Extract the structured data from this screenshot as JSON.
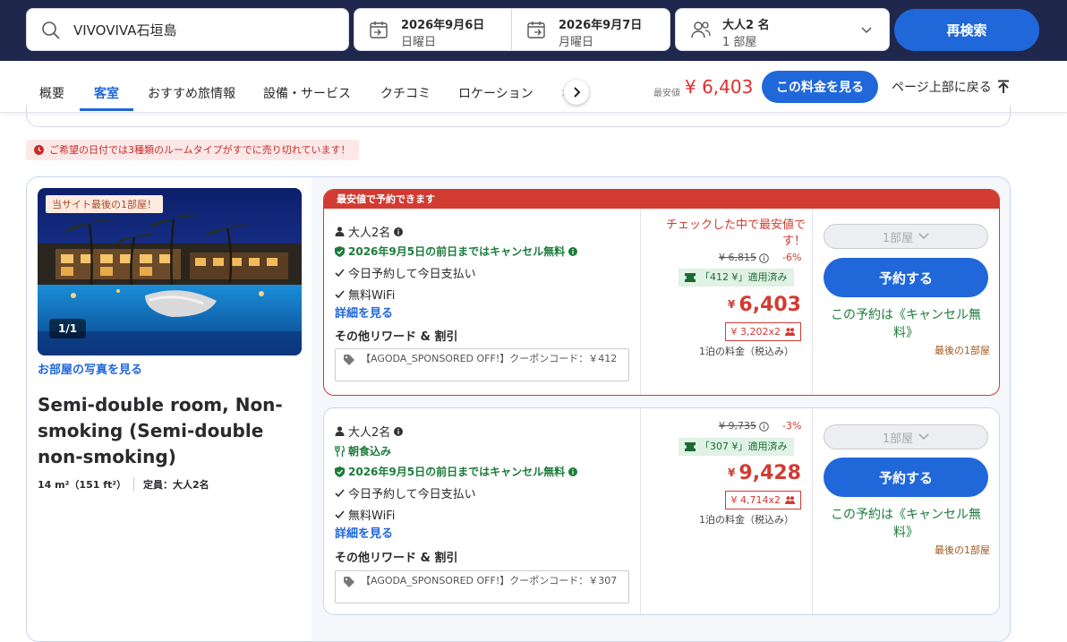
{
  "search": {
    "query": "VIVOVIVA石垣島"
  },
  "checkin": {
    "date": "2026年9月6日",
    "weekday": "日曜日"
  },
  "checkout": {
    "date": "2026年9月7日",
    "weekday": "月曜日"
  },
  "guests": {
    "adults": "大人2 名",
    "rooms": "1 部屋"
  },
  "research_label": "再検索",
  "nav": {
    "tabs": [
      "概要",
      "客室",
      "おすすめ旅情報",
      "設備・サービス",
      "クチコミ",
      "ロケーション"
    ],
    "hidden_tab_fragment": "ポ",
    "min_label": "最安値",
    "min_price": "¥ 6,403",
    "see_price": "この料金を見る",
    "back_top": "ページ上部に戻る"
  },
  "soldout_notice": "ご希望の日付では3種類のルームタイプがすでに売り切れています！",
  "room": {
    "last_room_badge": "当サイト最後の1部屋！",
    "photo_counter": "1/1",
    "photo_link": "お部屋の写真を見る",
    "name": "Semi-double room, Non-smoking (Semi-double non-smoking)",
    "size": "14 m²（151 ft²）",
    "capacity": "定員：大人2名"
  },
  "offers": [
    {
      "best_label": "最安値で予約できます",
      "occupancy": "大人2名",
      "breakfast": "",
      "free_cancel": "2026年9月5日の前日まではキャンセル無料",
      "pay_today": "今日予約して今日支払い",
      "wifi": "無料WiFi",
      "detail": "詳細を見る",
      "rewards": "その他リワード & 割引",
      "coupon": "【AGODA_SPONSORED OFF!】クーポンコード：￥412",
      "cheapest_note": "チェックした中で最安値です！",
      "original_price": "¥ 6,815",
      "discount": "-6%",
      "applied": "「412 ¥」適用済み",
      "price_yen": "¥",
      "price": "6,403",
      "per_person": "¥ 3,202x2",
      "per_night": "1泊の料金（税込み）",
      "qty": "1部屋",
      "book": "予約する",
      "cancel_note": "この予約は《キャンセル無料》",
      "last_room": "最後の1部屋"
    },
    {
      "best_label": "",
      "occupancy": "大人2名",
      "breakfast": "朝食込み",
      "free_cancel": "2026年9月5日の前日まではキャンセル無料",
      "pay_today": "今日予約して今日支払い",
      "wifi": "無料WiFi",
      "detail": "詳細を見る",
      "rewards": "その他リワード & 割引",
      "coupon": "【AGODA_SPONSORED OFF!】クーポンコード：￥307",
      "cheapest_note": "",
      "original_price": "¥ 9,735",
      "discount": "-3%",
      "applied": "「307 ¥」適用済み",
      "price_yen": "¥",
      "price": "9,428",
      "per_person": "¥ 4,714x2",
      "per_night": "1泊の料金（税込み）",
      "qty": "1部屋",
      "book": "予約する",
      "cancel_note": "この予約は《キャンセル無料》",
      "last_room": "最後の1部屋"
    }
  ],
  "colors": {
    "navy": "#20274d",
    "primary": "#2067da",
    "red": "#d23b32",
    "green": "#1b7c3a"
  }
}
